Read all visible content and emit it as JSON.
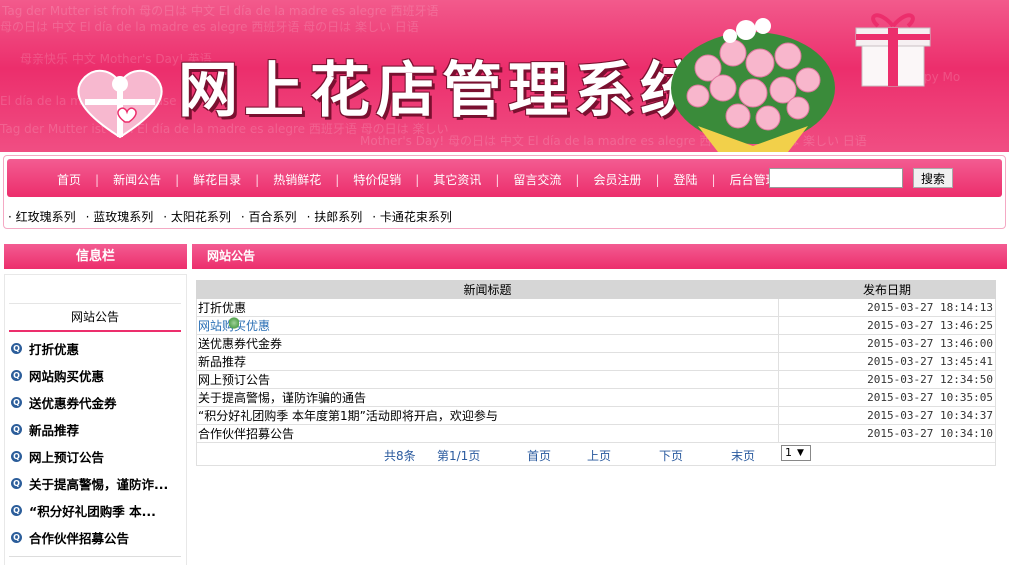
{
  "banner": {
    "title": "网上花店管理系统"
  },
  "nav": {
    "items": [
      "首页",
      "新闻公告",
      "鲜花目录",
      "热销鲜花",
      "特价促销",
      "其它资讯",
      "留言交流",
      "会员注册",
      "登陆",
      "后台管理"
    ],
    "search_button": "搜索",
    "search_value": ""
  },
  "categories": [
    "· 红玫瑰系列",
    "· 蓝玫瑰系列",
    "· 太阳花系列",
    "· 百合系列",
    "· 扶郎系列",
    "· 卡通花束系列"
  ],
  "sidebar": {
    "header": "信息栏",
    "section_title": "网站公告",
    "items": [
      "打折优惠",
      "网站购买优惠",
      "送优惠券代金券",
      "新品推荐",
      "网上预订公告",
      "关于提高警惕，谨防诈...",
      "“积分好礼团购季 本...",
      "合作伙伴招募公告"
    ]
  },
  "main": {
    "header": "网站公告",
    "columns": [
      "新闻标题",
      "发布日期"
    ],
    "rows": [
      {
        "title": "打折优惠",
        "date": "2015-03-27 18:14:13"
      },
      {
        "title": "网站购买优惠",
        "date": "2015-03-27 13:46:25"
      },
      {
        "title": "送优惠券代金券",
        "date": "2015-03-27 13:46:00"
      },
      {
        "title": "新品推荐",
        "date": "2015-03-27 13:45:41"
      },
      {
        "title": "网上预订公告",
        "date": "2015-03-27 12:34:50"
      },
      {
        "title": "关于提高警惕，谨防诈骗的通告",
        "date": "2015-03-27 10:35:05"
      },
      {
        "title": "“积分好礼团购季 本年度第1期”活动即将开启，欢迎参与",
        "date": "2015-03-27 10:34:37"
      },
      {
        "title": "合作伙伴招募公告",
        "date": "2015-03-27 10:34:10"
      }
    ],
    "pager": {
      "total": "共8条",
      "page": "第1/1页",
      "first": "首页",
      "prev": "上页",
      "next": "下页",
      "last": "末页",
      "select_value": "1"
    }
  },
  "colors": {
    "accent": "#ec2e6c",
    "link": "#2a5a9e"
  }
}
